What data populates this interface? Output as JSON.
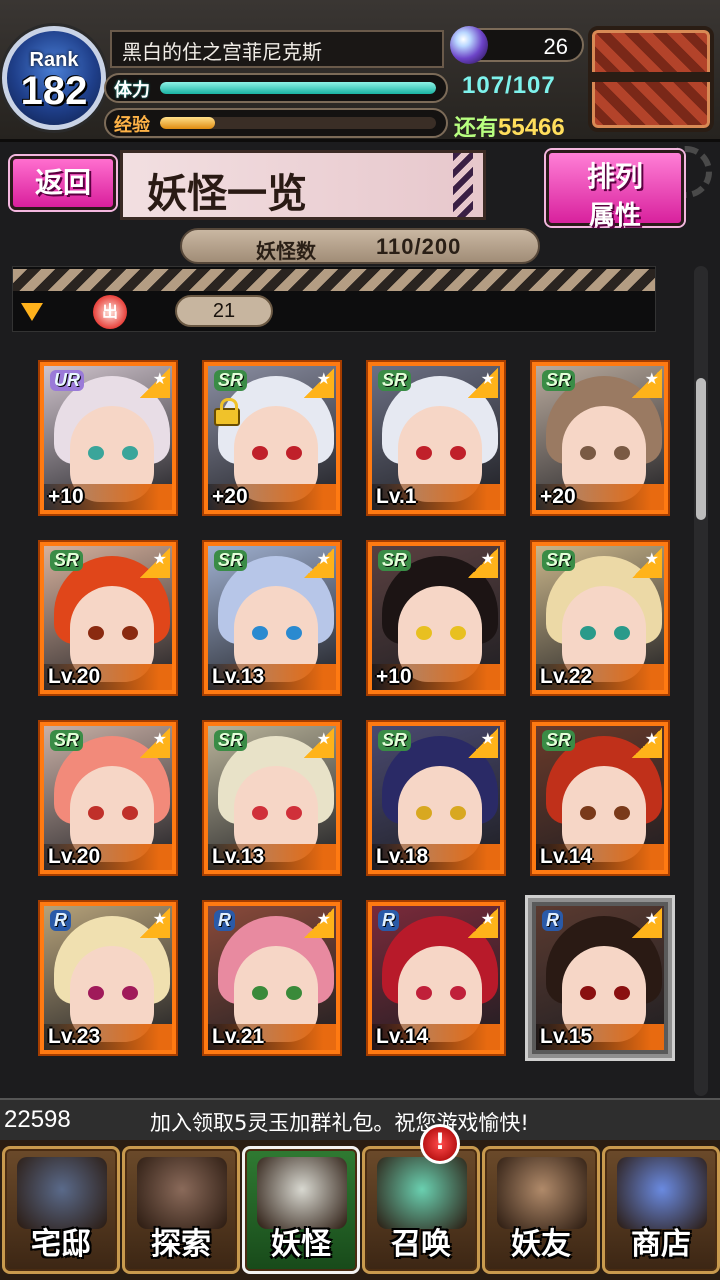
{
  "player": {
    "rank_label": "Rank",
    "rank_value": "182",
    "name": "黑白的住之宫菲尼克斯",
    "stamina_label": "体力",
    "stamina_text": "107/107",
    "stamina_fraction": 1.0,
    "exp_label": "经验",
    "exp_fraction": 0.2,
    "exp_remaining_prefix": "还有",
    "exp_remaining_value": "55466",
    "gem_count": "26"
  },
  "header": {
    "back_label": "返回",
    "title": "妖怪一览",
    "sort_top": "排列",
    "sort_bottom": "属性"
  },
  "count_bar": {
    "label": "妖怪数",
    "value": "110/200"
  },
  "filter": {
    "out_icon_text": "出",
    "count": "21"
  },
  "scroll_fraction": 0.12,
  "cards": [
    {
      "rarity": "UR",
      "level": "+10",
      "hair": "#e8dde6",
      "eyes": "#3aa59a",
      "bg": "#cfc3cc",
      "locked": false,
      "selected": false
    },
    {
      "rarity": "SR",
      "level": "+20",
      "hair": "#e6e9f2",
      "eyes": "#c0202a",
      "bg": "#8a8ea2",
      "locked": true,
      "selected": false
    },
    {
      "rarity": "SR",
      "level": "Lv.1",
      "hair": "#e6e9f2",
      "eyes": "#c0202a",
      "bg": "#6c7084",
      "locked": false,
      "selected": false
    },
    {
      "rarity": "SR",
      "level": "+20",
      "hair": "#9a7a62",
      "eyes": "#7a5a44",
      "bg": "#b9aa9d",
      "locked": false,
      "selected": false
    },
    {
      "rarity": "SR",
      "level": "Lv.20",
      "hair": "#e0461a",
      "eyes": "#8a2a10",
      "bg": "#d6b19d",
      "locked": false,
      "selected": false
    },
    {
      "rarity": "SR",
      "level": "Lv.13",
      "hair": "#b7c6e8",
      "eyes": "#2a8ad0",
      "bg": "#9fb0d0",
      "locked": false,
      "selected": false
    },
    {
      "rarity": "SR",
      "level": "+10",
      "hair": "#1c1414",
      "eyes": "#e8c020",
      "bg": "#5a4040",
      "locked": false,
      "selected": false
    },
    {
      "rarity": "SR",
      "level": "Lv.22",
      "hair": "#ecd9a6",
      "eyes": "#2a9a8a",
      "bg": "#c9b58a",
      "locked": false,
      "selected": false
    },
    {
      "rarity": "SR",
      "level": "Lv.20",
      "hair": "#f28a7a",
      "eyes": "#c0302a",
      "bg": "#c9b0a6",
      "locked": false,
      "selected": false
    },
    {
      "rarity": "SR",
      "level": "Lv.13",
      "hair": "#e8e2c8",
      "eyes": "#d0303a",
      "bg": "#b9b39a",
      "locked": false,
      "selected": false
    },
    {
      "rarity": "SR",
      "level": "Lv.18",
      "hair": "#2a2a66",
      "eyes": "#d8a820",
      "bg": "#4a4a70",
      "locked": false,
      "selected": false
    },
    {
      "rarity": "SR",
      "level": "Lv.14",
      "hair": "#c0301a",
      "eyes": "#7a3a1a",
      "bg": "#6a3a2a",
      "locked": false,
      "selected": false
    },
    {
      "rarity": "R",
      "level": "Lv.23",
      "hair": "#f0e0b0",
      "eyes": "#a01a5a",
      "bg": "#b6a27a",
      "locked": false,
      "selected": false
    },
    {
      "rarity": "R",
      "level": "Lv.21",
      "hair": "#e88aa0",
      "eyes": "#3a8a3a",
      "bg": "#8a4a3a",
      "locked": false,
      "selected": false
    },
    {
      "rarity": "R",
      "level": "Lv.14",
      "hair": "#b81a2a",
      "eyes": "#c0203a",
      "bg": "#7a2a3a",
      "locked": false,
      "selected": false
    },
    {
      "rarity": "R",
      "level": "Lv.15",
      "hair": "#2a1a14",
      "eyes": "#8a1010",
      "bg": "#5a3a30",
      "locked": false,
      "selected": true
    }
  ],
  "ticker": {
    "number": "22598",
    "message": "加入领取5灵玉加群礼包。祝您游戏愉快!"
  },
  "nav": [
    {
      "label": "宅邸",
      "art": "#5a6a8a",
      "active": false
    },
    {
      "label": "探索",
      "art": "#8a6a5a",
      "active": false
    },
    {
      "label": "妖怪",
      "art": "#d8d8d0",
      "active": true
    },
    {
      "label": "召唤",
      "art": "#6ad0b0",
      "active": false
    },
    {
      "label": "妖友",
      "art": "#b08a6a",
      "active": false
    },
    {
      "label": "商店",
      "art": "#6a8ae0",
      "active": false
    }
  ],
  "nav_alert": "!"
}
